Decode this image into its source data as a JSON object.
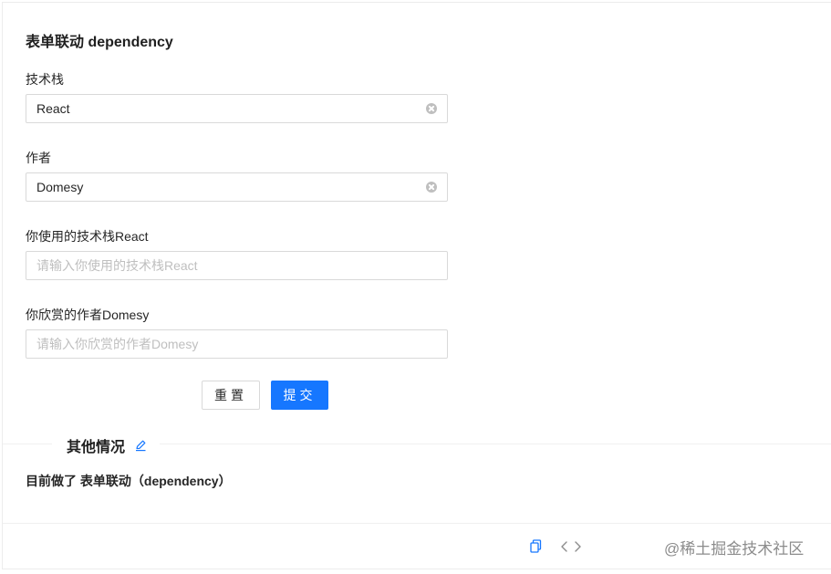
{
  "form": {
    "title": "表单联动 dependency",
    "fields": [
      {
        "label": "技术栈",
        "value": "React",
        "placeholder": ""
      },
      {
        "label": "作者",
        "value": "Domesy",
        "placeholder": ""
      },
      {
        "label": "你使用的技术栈React",
        "value": "",
        "placeholder": "请输入你使用的技术栈React"
      },
      {
        "label": "你欣赏的作者Domesy",
        "value": "",
        "placeholder": "请输入你欣赏的作者Domesy"
      }
    ],
    "reset_label": "重置",
    "submit_label": "提交"
  },
  "section": {
    "title": "其他情况",
    "description": "目前做了 表单联动（dependency）"
  },
  "footer": {
    "icons": [
      "copy-icon",
      "code-icon"
    ]
  },
  "watermark": "@稀土掘金技术社区",
  "colors": {
    "primary": "#1677ff",
    "border": "#d9d9d9",
    "placeholder": "#bfbfbf"
  }
}
